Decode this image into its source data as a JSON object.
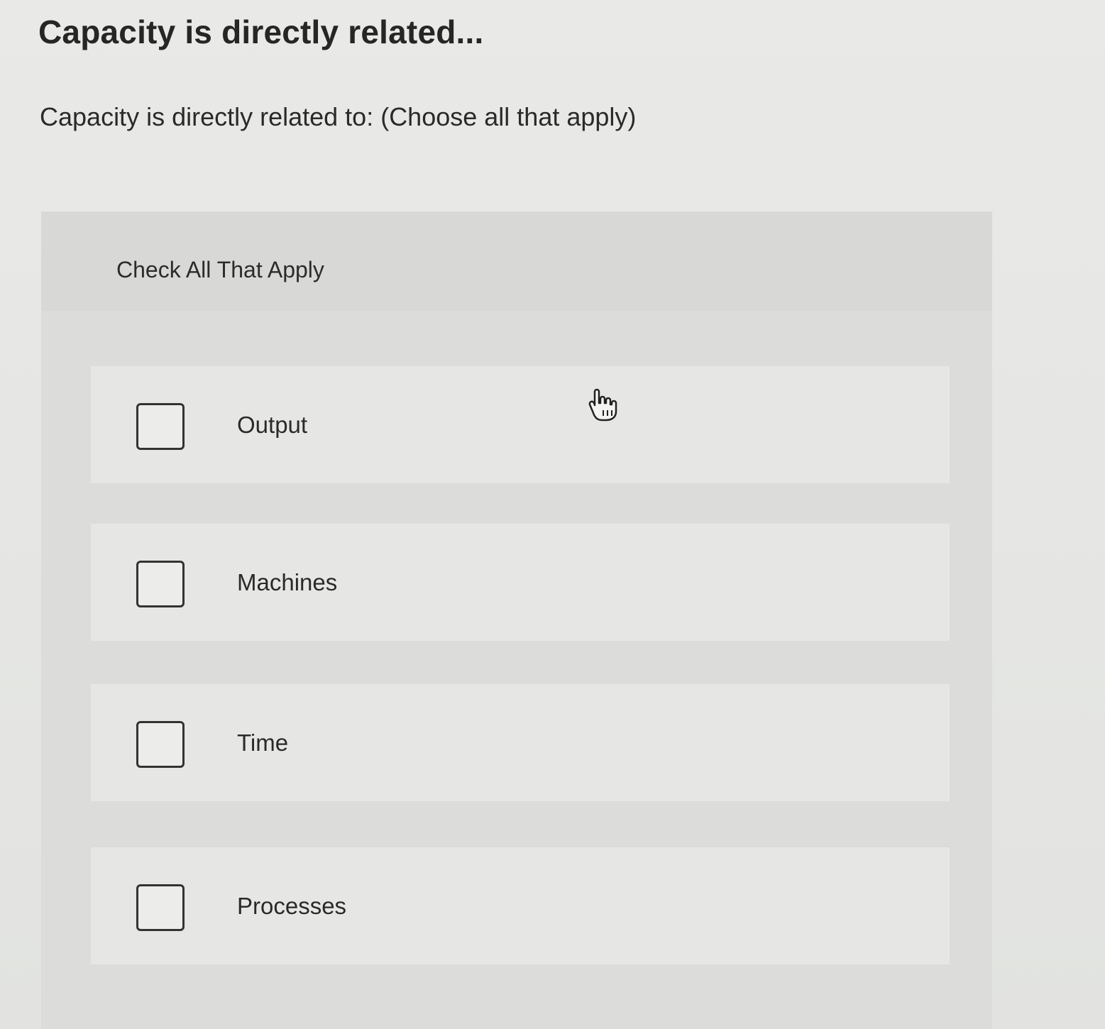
{
  "question": {
    "title": "Capacity is directly related...",
    "prompt": "Capacity is directly related to: (Choose all that apply)"
  },
  "answer_panel": {
    "header": "Check All That Apply",
    "options": [
      {
        "label": "Output",
        "checked": false
      },
      {
        "label": "Machines",
        "checked": false
      },
      {
        "label": "Time",
        "checked": false
      },
      {
        "label": "Processes",
        "checked": false
      }
    ]
  },
  "icons": {
    "cursor": "hand-pointer-icon"
  }
}
